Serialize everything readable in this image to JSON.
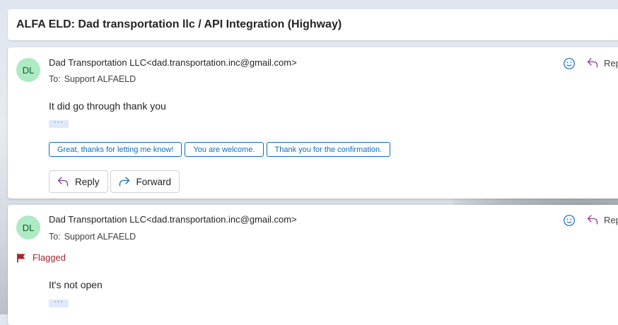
{
  "subject": "ALFA ELD: Dad transportation llc / API Integration (Highway)",
  "messages": [
    {
      "avatar": "DL",
      "sender": "Dad Transportation LLC<dad.transportation.inc@gmail.com>",
      "to_label": "To:",
      "to": "Support ALFAELD",
      "body": "It did go through thank you",
      "ellipsis": "···",
      "quick_replies": [
        "Great, thanks for letting me know!",
        "You are welcome.",
        "Thank you for the confirmation."
      ],
      "reply_label": "Reply",
      "forward_label": "Forward",
      "header_reply_label": "Rep"
    },
    {
      "avatar": "DL",
      "sender": "Dad Transportation LLC<dad.transportation.inc@gmail.com>",
      "to_label": "To:",
      "to": "Support ALFAELD",
      "flag_label": "Flagged",
      "body": "It's not open",
      "ellipsis": "···",
      "header_reply_label": "Rep"
    }
  ],
  "colors": {
    "accent": "#0f6cbd",
    "flag": "#a4262c",
    "avatar_bg": "#aeeac4",
    "reply_arrow": "#8e3c9a"
  }
}
